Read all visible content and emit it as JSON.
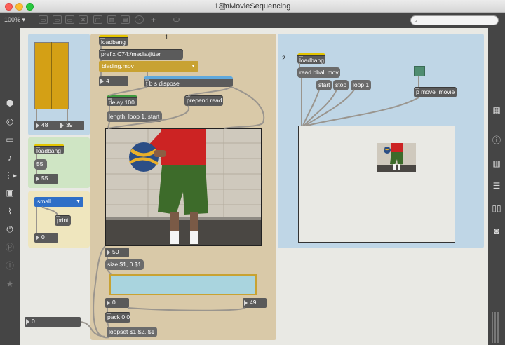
{
  "window": {
    "title": "13mMovieSequencing"
  },
  "toolbar": {
    "zoom": "100% ▾"
  },
  "colors": {
    "panel_blue": "#bfd6e6",
    "panel_green": "#cfe5c4",
    "panel_yellow": "#efe6be",
    "panel_tan": "#d9c9a8",
    "slider_fill": "#d4a015",
    "jit_pwindow_bg": "#a9d4de",
    "accent_border": "#c8a232"
  },
  "left_sidebar": {
    "icons": [
      "cube-icon",
      "circle-target-icon",
      "mic-icon",
      "note-icon",
      "sequence-icon",
      "image-icon",
      "paperclip-icon",
      "plug-icon",
      "p-icon",
      "info-icon",
      "star-icon"
    ]
  },
  "right_sidebar": {
    "icons": [
      "grid-icon",
      "info-icon",
      "book-icon",
      "list-icon",
      "open-book-icon",
      "camera-icon"
    ]
  },
  "patch": {
    "comment_1": "1",
    "comment_2": "2",
    "sliders": {
      "left_value": "48",
      "right_value": "39"
    },
    "green_panel": {
      "loadbang": "loadbang",
      "msg_55": "55",
      "num_55": "55"
    },
    "yellow_panel": {
      "umenu": "small",
      "print": "print",
      "num_0": "0"
    },
    "tan_panel": {
      "loadbang": "loadbang",
      "prefix": "prefix C74:/media/jitter",
      "umenu": "blading.mov",
      "num_4": "4",
      "tbs": "t b s dispose",
      "delay": "delay 100",
      "prepend": "prepend read",
      "length": "length, loop 1, start",
      "num_50": "50",
      "size_msg": "size $1, 0 $1",
      "num_0": "0",
      "num_49": "49",
      "pack": "pack 0 0",
      "loopset": "loopset $1 $2, $1"
    },
    "bottom_num": "0",
    "blue_panel": {
      "loadbang": "loadbang",
      "read": "read bball.mov",
      "start": "start",
      "stop": "stop",
      "loop": "loop 1",
      "subpatch": "p move_movie"
    }
  }
}
